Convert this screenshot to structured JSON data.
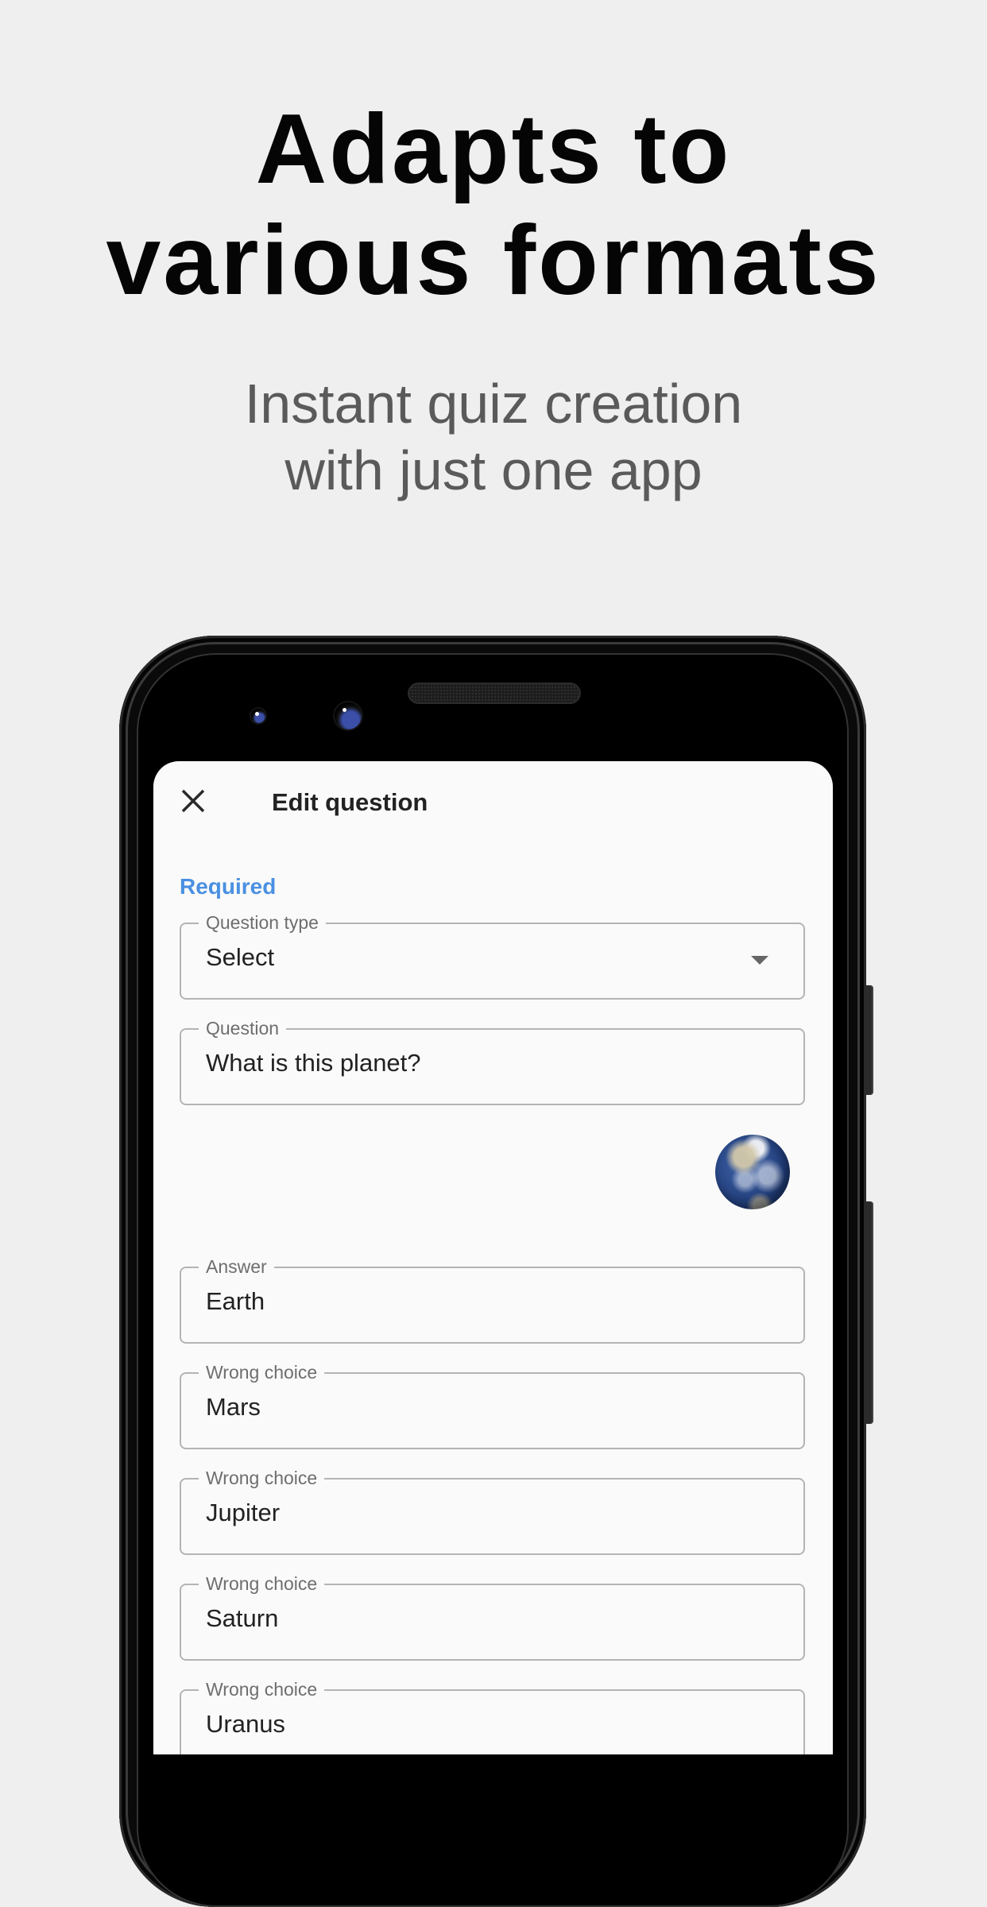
{
  "promo": {
    "headline_lines": [
      "Adapts to",
      "various formats"
    ],
    "subhead_lines": [
      "Instant quiz creation",
      "with just one app"
    ]
  },
  "app": {
    "title": "Edit question",
    "close_icon": "close-icon",
    "section_label": "Required",
    "accent_color": "#4a90e2",
    "fields": {
      "question_type": {
        "label": "Question type",
        "value": "Select",
        "icon": "dropdown-arrow-icon"
      },
      "question": {
        "label": "Question",
        "value": "What is this planet?"
      },
      "image": {
        "description": "earth-globe-image"
      },
      "answer": {
        "label": "Answer",
        "value": "Earth"
      },
      "wrong_choices": [
        {
          "label": "Wrong choice",
          "value": "Mars"
        },
        {
          "label": "Wrong choice",
          "value": "Jupiter"
        },
        {
          "label": "Wrong choice",
          "value": "Saturn"
        },
        {
          "label": "Wrong choice",
          "value": "Uranus"
        }
      ]
    }
  }
}
